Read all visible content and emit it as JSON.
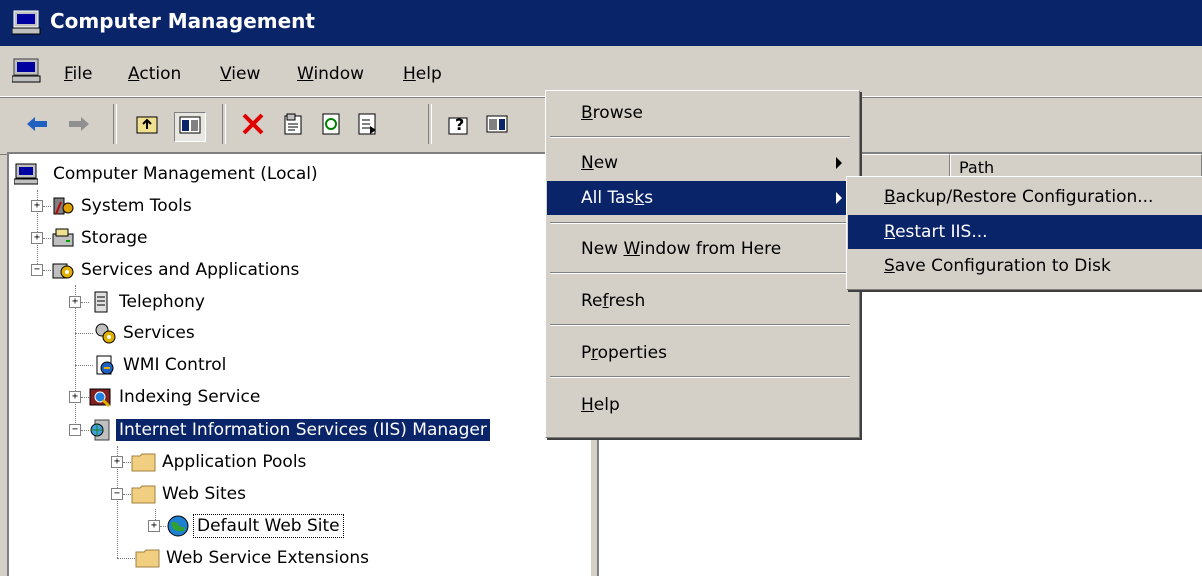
{
  "window": {
    "title": "Computer Management"
  },
  "menubar": {
    "items": [
      {
        "label": "File",
        "accel": "F",
        "rest": "ile"
      },
      {
        "label": "Action",
        "accel": "A",
        "rest": "ction"
      },
      {
        "label": "View",
        "accel": "V",
        "rest": "iew"
      },
      {
        "label": "Window",
        "accel": "W",
        "rest": "indow"
      },
      {
        "label": "Help",
        "accel": "H",
        "rest": "elp"
      }
    ]
  },
  "toolbar": {
    "buttons": [
      "back-icon",
      "forward-icon",
      "up-folder-icon",
      "show-hide-tree-icon",
      "delete-icon",
      "properties-icon",
      "refresh-icon",
      "export-list-icon",
      "help-icon",
      "show-hide-action-pane-icon"
    ]
  },
  "tree": {
    "items": [
      {
        "label": "Computer Management (Local)",
        "icon": "computer-icon"
      },
      {
        "label": "System Tools",
        "icon": "system-tools-icon",
        "expander": "+"
      },
      {
        "label": "Storage",
        "icon": "storage-icon",
        "expander": "+"
      },
      {
        "label": "Services and Applications",
        "icon": "services-apps-icon",
        "expander": "-"
      },
      {
        "label": "Telephony",
        "icon": "telephony-icon",
        "expander": "+"
      },
      {
        "label": "Services",
        "icon": "services-icon"
      },
      {
        "label": "WMI Control",
        "icon": "wmi-icon"
      },
      {
        "label": "Indexing Service",
        "icon": "indexing-icon",
        "expander": "+"
      },
      {
        "label": "Internet Information Services (IIS) Manager",
        "icon": "iis-icon",
        "expander": "-",
        "selected": true
      },
      {
        "label": "Application Pools",
        "icon": "folder-icon",
        "expander": "+"
      },
      {
        "label": "Web Sites",
        "icon": "folder-icon",
        "expander": "-"
      },
      {
        "label": "Default Web Site",
        "icon": "globe-icon",
        "expander": "+",
        "focused": true
      },
      {
        "label": "Web Service Extensions",
        "icon": "folder-icon"
      }
    ]
  },
  "right_pane": {
    "columns": [
      "",
      "Path"
    ]
  },
  "context_menu": {
    "items": [
      {
        "label": "Browse",
        "accel": "B",
        "rest": "rowse"
      },
      {
        "label": "New",
        "accel": "N",
        "rest": "ew"
      },
      {
        "label": "All Tasks",
        "pre": "All Tas",
        "accel": "k",
        "rest": "s"
      },
      {
        "label": "New Window from Here",
        "pre": "New ",
        "accel": "W",
        "rest": "indow from Here"
      },
      {
        "label": "Refresh",
        "pre": "Re",
        "accel": "f",
        "rest": "resh"
      },
      {
        "label": "Properties",
        "pre": "P",
        "accel": "r",
        "rest": "operties"
      },
      {
        "label": "Help",
        "accel": "H",
        "rest": "elp"
      }
    ]
  },
  "submenu": {
    "items": [
      {
        "label": "Backup/Restore Configuration...",
        "accel": "B",
        "rest": "ackup/Restore Configuration..."
      },
      {
        "label": "Restart IIS...",
        "accel": "R",
        "rest": "estart IIS..."
      },
      {
        "label": "Save Configuration to Disk",
        "accel": "S",
        "rest": "ave Configuration to Disk"
      }
    ]
  },
  "colors": {
    "selection": "#0a246a",
    "face": "#d4d0c8"
  }
}
